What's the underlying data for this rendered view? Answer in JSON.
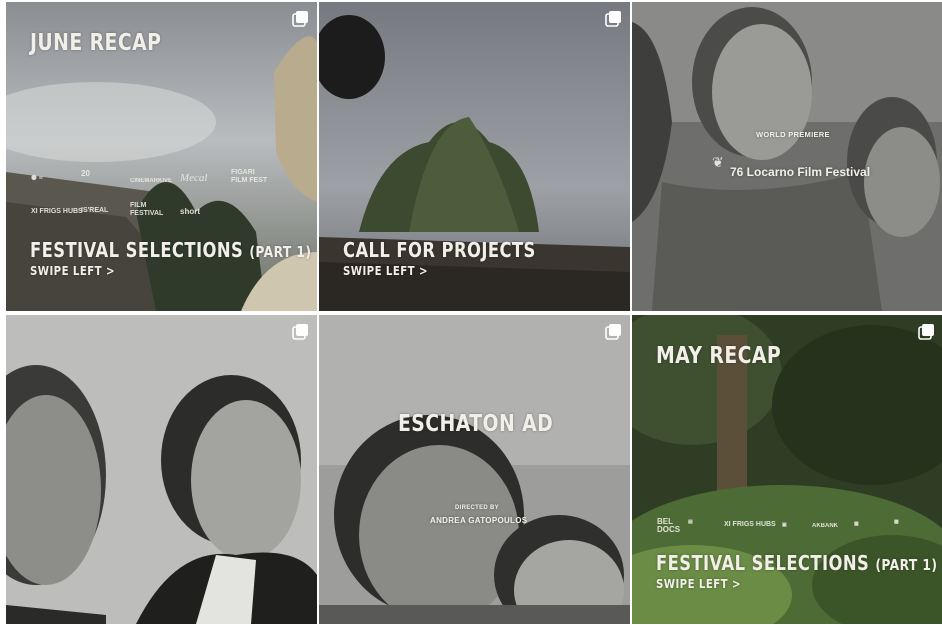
{
  "posts": [
    {
      "title": "JUNE RECAP",
      "logos": [
        "20",
        "CINEMARKIVE",
        "Mecal",
        "FIGARI FILM FEST",
        "XI FRIGS HUBS",
        "IS'REAL",
        "FILM FESTIVAL",
        "short"
      ],
      "caption_main": "FESTIVAL SELECTIONS",
      "caption_paren": "(PART 1)",
      "swipe": "SWIPE LEFT >",
      "icon": "multiple-images-icon"
    },
    {
      "caption_main": "CALL FOR PROJECTS",
      "swipe": "SWIPE LEFT >",
      "icon": "multiple-images-icon"
    },
    {
      "premiere_label": "WORLD PREMIERE",
      "festival": "76 Locarno Film Festival"
    },
    {
      "icon": "multiple-images-icon"
    },
    {
      "title": "ESCHATON AD",
      "credit_label": "DIRECTED BY",
      "credit_name": "ANDREA GATOPOULOS",
      "icon": "multiple-images-icon"
    },
    {
      "title": "MAY RECAP",
      "logos": [
        "BEL DOCS",
        "XI FRIGS HUBS",
        "AKBANK"
      ],
      "caption_main": "FESTIVAL SELECTIONS",
      "caption_paren": "(PART 1)",
      "swipe": "SWIPE LEFT >",
      "icon": "multiple-images-icon"
    }
  ],
  "colors": {
    "overlay_text": "#f1efe8",
    "background": "#ffffff"
  }
}
